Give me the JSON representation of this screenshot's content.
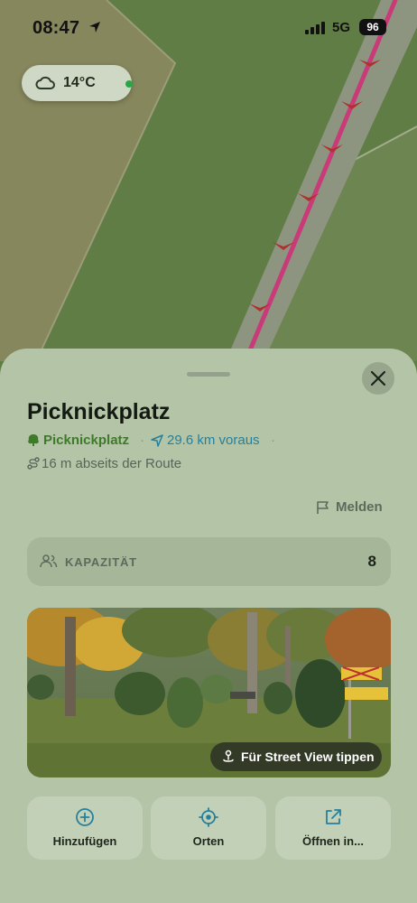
{
  "status_bar": {
    "time": "08:47",
    "network": "5G",
    "battery": "96"
  },
  "weather": {
    "temperature": "14°C",
    "icon": "cloud-icon",
    "status_color": "#27a745"
  },
  "poi": {
    "title": "Picknickplatz",
    "category": "Picknickplatz",
    "category_icon": "tree-icon",
    "separator": "·",
    "distance_ahead": "29.6 km voraus",
    "off_route": "16 m abseits der Route",
    "report_label": "Melden",
    "capacity": {
      "label": "KAPAZITÄT",
      "value": "8"
    },
    "photo": {
      "street_view_label": "Für Street View tippen"
    },
    "actions": [
      {
        "label": "Hinzufügen",
        "icon": "add-circle-icon"
      },
      {
        "label": "Orten",
        "icon": "locate-icon"
      },
      {
        "label": "Öffnen in...",
        "icon": "external-link-icon"
      }
    ]
  },
  "colors": {
    "map_forest": "#5f7d45",
    "map_field": "#87875d",
    "route": "#c93a79",
    "sheet": "#b3c4a7",
    "category_green": "#3f7a2a",
    "distance_blue": "#26809c"
  }
}
